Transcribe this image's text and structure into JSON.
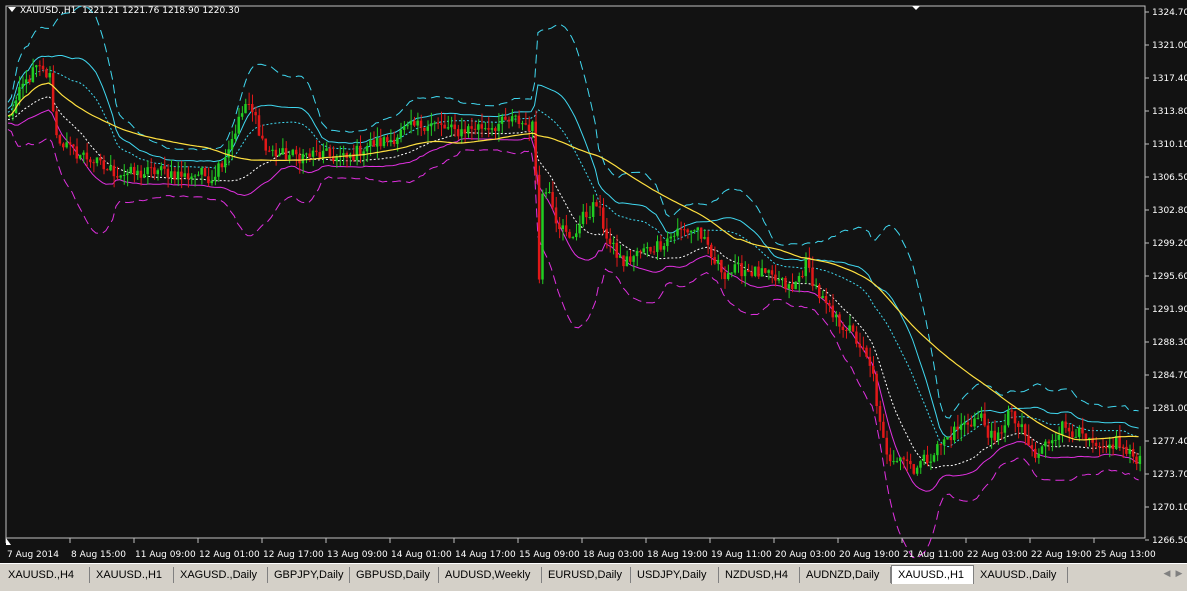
{
  "header": {
    "symbol": "XAUUSD.,H1",
    "ohlc": "1221.21 1221.76 1218.90 1220.30"
  },
  "colors": {
    "background": "#121212",
    "bull_candle": "#22cc22",
    "bear_candle": "#e01818",
    "ma_yellow": "#ffe040",
    "band_cyan": "#40d8f0",
    "band_magenta": "#e030e0",
    "grid_text": "#ffffff"
  },
  "tabs": [
    {
      "label": "XAUUSD.,H4"
    },
    {
      "label": "XAUUSD.,H1"
    },
    {
      "label": "XAGUSD.,Daily"
    },
    {
      "label": "GBPJPY,Daily"
    },
    {
      "label": "GBPUSD,Daily"
    },
    {
      "label": "AUDUSD,Weekly"
    },
    {
      "label": "EURUSD,Daily"
    },
    {
      "label": "USDJPY,Daily"
    },
    {
      "label": "NZDUSD,H4"
    },
    {
      "label": "AUDNZD,Daily"
    },
    {
      "label": "XAUUSD.,H1",
      "active": true
    },
    {
      "label": "XAUUSD.,Daily"
    }
  ],
  "chart_data": {
    "type": "candlestick",
    "symbol": "XAUUSD.,H1",
    "ylim": [
      1266.5,
      1324.7
    ],
    "y_ticks": [
      "1324.70",
      "1321.00",
      "1317.40",
      "1313.80",
      "1310.10",
      "1306.50",
      "1302.80",
      "1299.20",
      "1295.60",
      "1291.90",
      "1288.30",
      "1284.70",
      "1281.00",
      "1277.40",
      "1273.70",
      "1270.10",
      "1266.50"
    ],
    "x_ticks": [
      "7 Aug 2014",
      "8 Aug 15:00",
      "11 Aug 09:00",
      "12 Aug 01:00",
      "12 Aug 17:00",
      "13 Aug 09:00",
      "14 Aug 01:00",
      "14 Aug 17:00",
      "15 Aug 09:00",
      "18 Aug 03:00",
      "18 Aug 19:00",
      "19 Aug 11:00",
      "20 Aug 03:00",
      "20 Aug 19:00",
      "21 Aug 11:00",
      "22 Aug 03:00",
      "22 Aug 19:00",
      "25 Aug 13:00"
    ],
    "close_path": [
      [
        0,
        1313.0
      ],
      [
        4,
        1316.5
      ],
      [
        8,
        1318.5
      ],
      [
        12,
        1317.5
      ],
      [
        14,
        1311.0
      ],
      [
        18,
        1309.5
      ],
      [
        24,
        1308.5
      ],
      [
        28,
        1307.5
      ],
      [
        32,
        1307.0
      ],
      [
        38,
        1306.8
      ],
      [
        44,
        1307.2
      ],
      [
        48,
        1307.0
      ],
      [
        52,
        1306.6
      ],
      [
        56,
        1306.9
      ],
      [
        60,
        1306.5
      ],
      [
        64,
        1309.0
      ],
      [
        70,
        1314.5
      ],
      [
        73,
        1313.0
      ],
      [
        76,
        1309.5
      ],
      [
        80,
        1309.0
      ],
      [
        86,
        1308.8
      ],
      [
        92,
        1309.0
      ],
      [
        100,
        1308.5
      ],
      [
        106,
        1310.0
      ],
      [
        112,
        1310.5
      ],
      [
        118,
        1311.8
      ],
      [
        124,
        1312.5
      ],
      [
        132,
        1311.5
      ],
      [
        138,
        1312.0
      ],
      [
        144,
        1312.2
      ],
      [
        150,
        1312.8
      ],
      [
        155,
        1312.0
      ],
      [
        156,
        1307.0
      ],
      [
        157,
        1296.0
      ],
      [
        158,
        1304.5
      ],
      [
        160,
        1305.5
      ],
      [
        162,
        1302.0
      ],
      [
        166,
        1299.5
      ],
      [
        170,
        1302.0
      ],
      [
        174,
        1303.5
      ],
      [
        178,
        1299.0
      ],
      [
        182,
        1297.0
      ],
      [
        186,
        1298.0
      ],
      [
        192,
        1299.0
      ],
      [
        198,
        1300.5
      ],
      [
        204,
        1300.8
      ],
      [
        206,
        1299.2
      ],
      [
        208,
        1297.5
      ],
      [
        212,
        1296.0
      ],
      [
        218,
        1296.4
      ],
      [
        224,
        1295.6
      ],
      [
        228,
        1295.0
      ],
      [
        232,
        1294.0
      ],
      [
        236,
        1297.0
      ],
      [
        240,
        1293.5
      ],
      [
        244,
        1291.0
      ],
      [
        248,
        1290.0
      ],
      [
        252,
        1288.0
      ],
      [
        256,
        1284.5
      ],
      [
        258,
        1279.0
      ],
      [
        260,
        1275.5
      ],
      [
        264,
        1276.0
      ],
      [
        268,
        1274.5
      ],
      [
        272,
        1275.5
      ],
      [
        276,
        1277.0
      ],
      [
        280,
        1278.5
      ],
      [
        284,
        1279.5
      ],
      [
        288,
        1280.0
      ],
      [
        292,
        1277.0
      ],
      [
        296,
        1280.5
      ],
      [
        300,
        1278.5
      ],
      [
        304,
        1275.5
      ],
      [
        308,
        1277.5
      ],
      [
        312,
        1279.0
      ],
      [
        316,
        1278.5
      ],
      [
        320,
        1277.0
      ],
      [
        324,
        1276.0
      ],
      [
        328,
        1277.5
      ],
      [
        331,
        1276.0
      ],
      [
        335,
        1275.5
      ]
    ],
    "indicators": [
      {
        "name": "MA",
        "color": "#ffe040"
      },
      {
        "name": "upper-band",
        "color": "#40d8f0"
      },
      {
        "name": "lower-band",
        "color": "#e030e0"
      }
    ]
  }
}
